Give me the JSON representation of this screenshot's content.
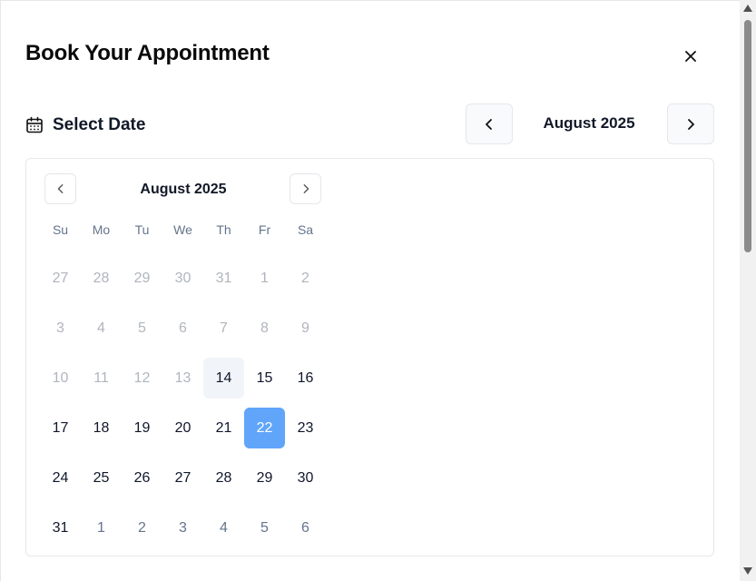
{
  "dialog": {
    "title": "Book Your Appointment",
    "close_icon": "close-icon"
  },
  "section": {
    "label": "Select Date",
    "icon": "calendar-icon"
  },
  "header_nav": {
    "month_label": "August 2025",
    "prev_icon": "chevron-left-icon",
    "next_icon": "chevron-right-icon"
  },
  "calendar": {
    "month_label": "August 2025",
    "weekdays": [
      "Su",
      "Mo",
      "Tu",
      "We",
      "Th",
      "Fr",
      "Sa"
    ],
    "weeks": [
      [
        {
          "d": "27",
          "s": "disabled"
        },
        {
          "d": "28",
          "s": "disabled"
        },
        {
          "d": "29",
          "s": "disabled"
        },
        {
          "d": "30",
          "s": "disabled"
        },
        {
          "d": "31",
          "s": "disabled"
        },
        {
          "d": "1",
          "s": "disabled"
        },
        {
          "d": "2",
          "s": "disabled"
        }
      ],
      [
        {
          "d": "3",
          "s": "disabled"
        },
        {
          "d": "4",
          "s": "disabled"
        },
        {
          "d": "5",
          "s": "disabled"
        },
        {
          "d": "6",
          "s": "disabled"
        },
        {
          "d": "7",
          "s": "disabled"
        },
        {
          "d": "8",
          "s": "disabled"
        },
        {
          "d": "9",
          "s": "disabled"
        }
      ],
      [
        {
          "d": "10",
          "s": "disabled"
        },
        {
          "d": "11",
          "s": "disabled"
        },
        {
          "d": "12",
          "s": "disabled"
        },
        {
          "d": "13",
          "s": "disabled"
        },
        {
          "d": "14",
          "s": "today"
        },
        {
          "d": "15",
          "s": "normal"
        },
        {
          "d": "16",
          "s": "normal"
        }
      ],
      [
        {
          "d": "17",
          "s": "normal"
        },
        {
          "d": "18",
          "s": "normal"
        },
        {
          "d": "19",
          "s": "normal"
        },
        {
          "d": "20",
          "s": "normal"
        },
        {
          "d": "21",
          "s": "normal"
        },
        {
          "d": "22",
          "s": "selected"
        },
        {
          "d": "23",
          "s": "normal"
        }
      ],
      [
        {
          "d": "24",
          "s": "normal"
        },
        {
          "d": "25",
          "s": "normal"
        },
        {
          "d": "26",
          "s": "normal"
        },
        {
          "d": "27",
          "s": "normal"
        },
        {
          "d": "28",
          "s": "normal"
        },
        {
          "d": "29",
          "s": "normal"
        },
        {
          "d": "30",
          "s": "normal"
        }
      ],
      [
        {
          "d": "31",
          "s": "normal"
        },
        {
          "d": "1",
          "s": "outside"
        },
        {
          "d": "2",
          "s": "outside"
        },
        {
          "d": "3",
          "s": "outside"
        },
        {
          "d": "4",
          "s": "outside"
        },
        {
          "d": "5",
          "s": "outside"
        },
        {
          "d": "6",
          "s": "outside"
        }
      ]
    ],
    "colors": {
      "selected_bg": "#60a5fa",
      "today_bg": "#f1f5f9",
      "disabled_text": "#b0b5bd",
      "outside_text": "#64748b"
    }
  }
}
